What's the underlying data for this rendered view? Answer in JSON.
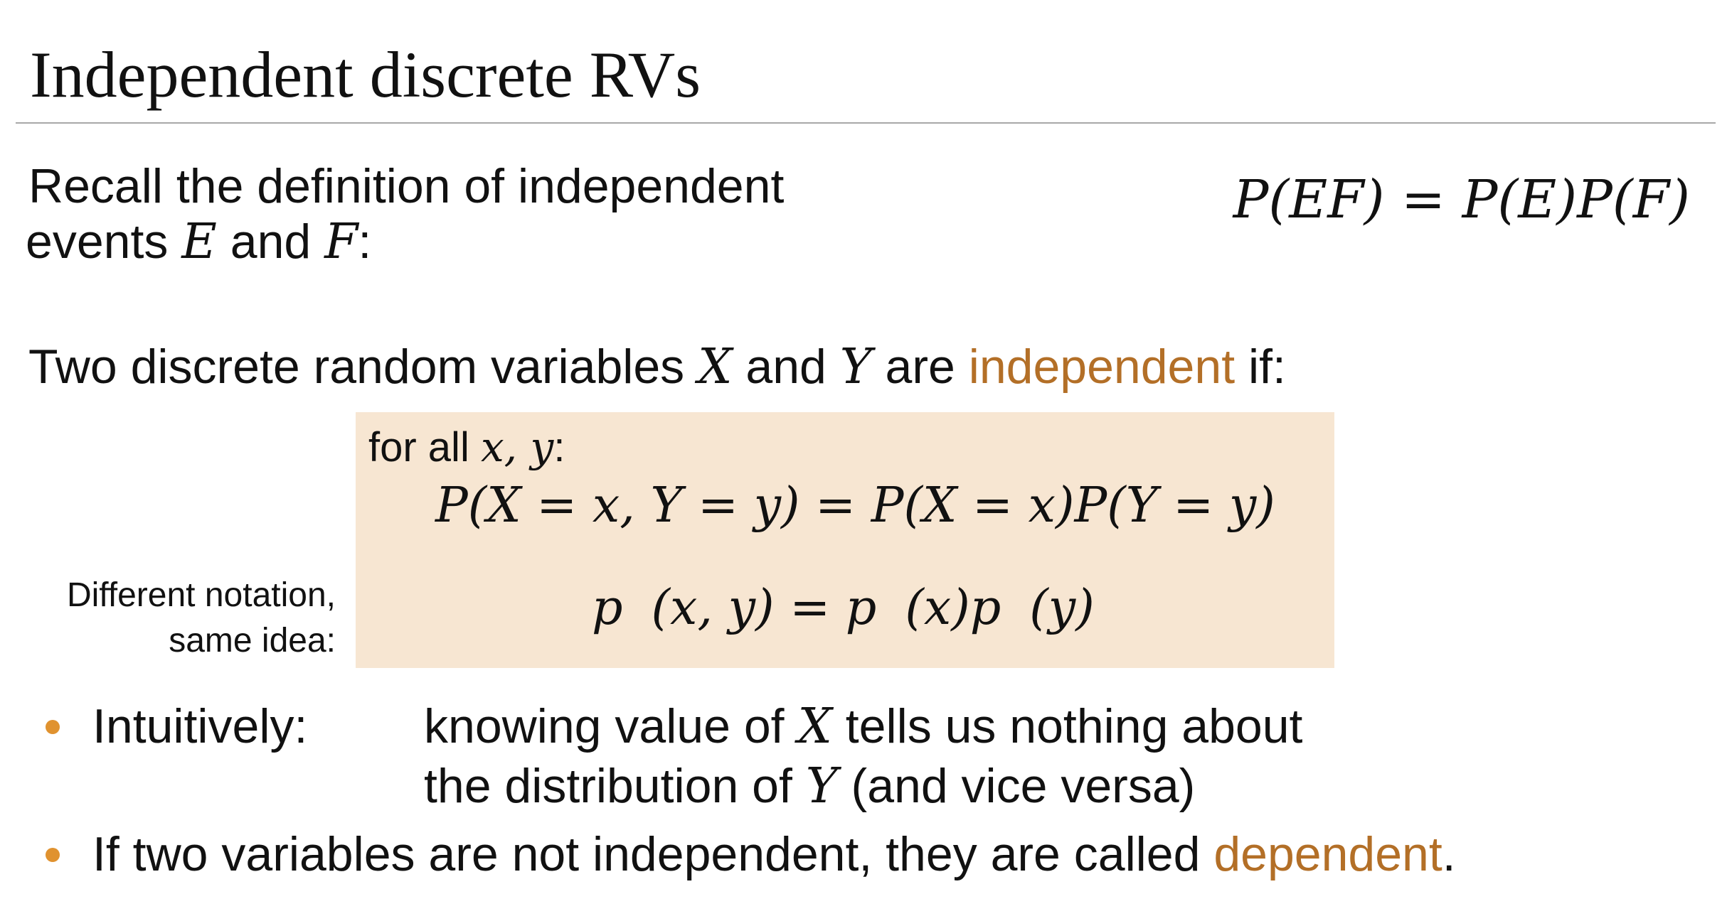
{
  "slide": {
    "title": "Independent discrete RVs",
    "recall": {
      "line1": "Recall the definition of independent",
      "line2_prefix": "events ",
      "var_e": "E",
      "and_word": " and ",
      "var_f": "F",
      "line2_suffix": ":",
      "formula": "P(EF) = P(E)P(F)"
    },
    "definition": {
      "prefix": "Two discrete random variables ",
      "var_x": "X",
      "and_word": " and ",
      "var_y": "Y",
      "middle": " are ",
      "highlight": "independent",
      "suffix": " if:"
    },
    "box": {
      "for_all_prefix": "for all ",
      "for_all_vars": "x, y",
      "for_all_suffix": ":",
      "equation1": "P(X = x, Y = y) = P(X = x)P(Y = y)",
      "equation2_p1": "p",
      "equation2_a1": "(x, y) = ",
      "equation2_p2": "p",
      "equation2_a2": "(x)",
      "equation2_p3": "p",
      "equation2_a3": "(y)"
    },
    "side_note": {
      "line1": "Different notation,",
      "line2": "same idea:"
    },
    "bullets": {
      "b1_label": "Intuitively:",
      "b1_line1_prefix": "knowing value of ",
      "b1_var_x": "X",
      "b1_line1_suffix": " tells us nothing about",
      "b1_line2_prefix": "the distribution of ",
      "b1_var_y": "Y",
      "b1_line2_suffix": " (and vice versa)",
      "b2_prefix": "If two variables are not independent, they are called ",
      "b2_highlight": "dependent",
      "b2_suffix": "."
    },
    "colors": {
      "accent": "#b36f27",
      "box_fill": "#f7e6d2",
      "bullet": "#e0922f",
      "rule": "#a8a8a8"
    }
  }
}
